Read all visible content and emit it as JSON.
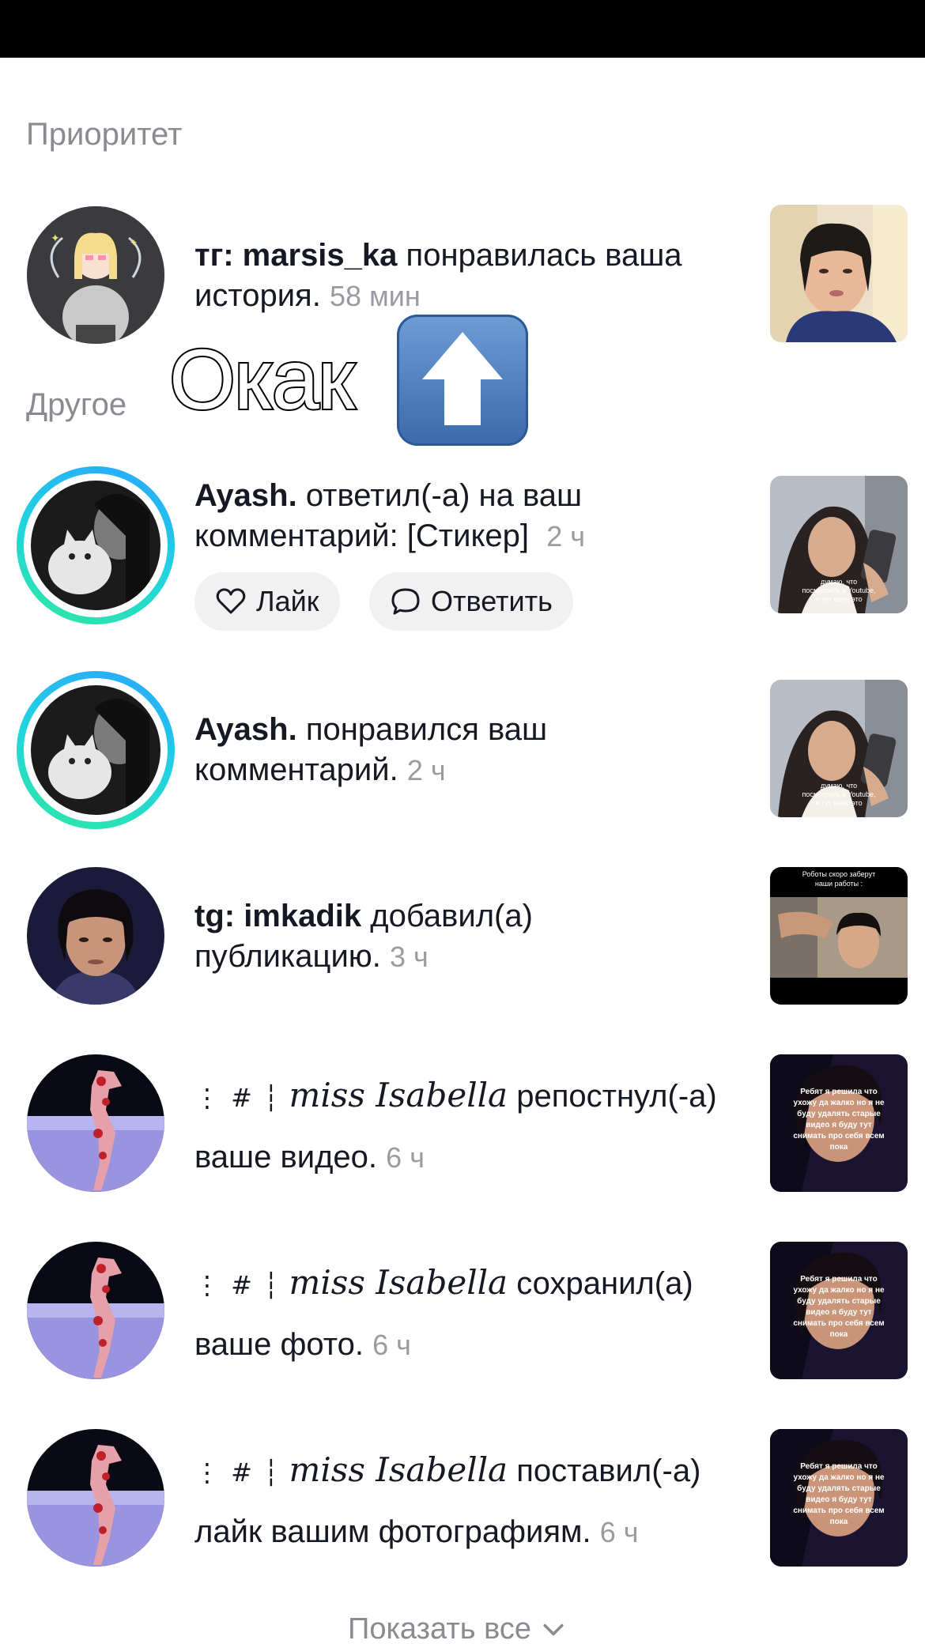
{
  "sections": {
    "priority": "Приоритет",
    "other": "Другое"
  },
  "notifications": [
    {
      "name": "тг: marsis_ka",
      "action": "понравилась ваша",
      "action2": "история.",
      "time": "58 мин"
    },
    {
      "name": "Ayash.",
      "action": "ответил(-а) на ваш",
      "action2": "комментарий: [Стикер]",
      "time": "2 ч",
      "like_label": "Лайк",
      "reply_label": "Ответить"
    },
    {
      "name": "Ayash.",
      "action": "понравился ваш",
      "action2": "комментарий.",
      "time": "2 ч"
    },
    {
      "name": "tg: imkadik",
      "action": "добавил(а)",
      "action2": "публикацию.",
      "time": "3 ч"
    },
    {
      "prefix": "⋮ # ┆",
      "name": "miss Isabella",
      "action": "репостнул(-а)",
      "action2": "ваше видео.",
      "time": "6 ч"
    },
    {
      "prefix": "⋮ # ┆",
      "name": "miss Isabella",
      "action": "сохранил(а)",
      "action2": "ваше фото.",
      "time": "6 ч"
    },
    {
      "prefix": "⋮ # ┆",
      "name": "miss Isabella",
      "action": "поставил(-а)",
      "action2": "лайк вашим фотографиям.",
      "time": "6 ч"
    }
  ],
  "thumb_captions": {
    "ayash": [
      "думаю, что",
      "посмотреть в Youtube,",
      "и тут вижу это"
    ],
    "imkadik": [
      "Роботы скоро заберут",
      "наши работы :"
    ],
    "isabella": [
      "Ребят я решила что",
      "ухожу да жалко но я не",
      "буду удалять старые",
      "видео я буду тут",
      "снимать про себя всем",
      "пока"
    ]
  },
  "overlay": {
    "okak_text": "Окак",
    "arrow_icon": "up-arrow-icon"
  },
  "footer": {
    "show_all": "Показать все"
  },
  "colors": {
    "ring_gradient_start": "#2aa4ff",
    "ring_gradient_end": "#2ee8a0",
    "muted_text": "#8a8b91",
    "pill_bg": "#f1f1f2"
  }
}
